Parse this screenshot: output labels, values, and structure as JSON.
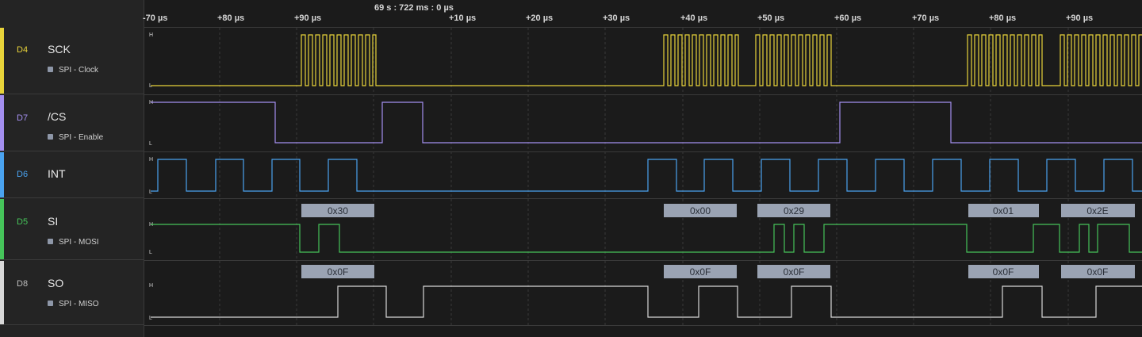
{
  "ruler": {
    "cursor_time": "69 s : 722 ms : 0 µs",
    "ticks": [
      "-70 µs",
      "+80 µs",
      "+90 µs",
      "+10 µs",
      "+20 µs",
      "+30 µs",
      "+40 µs",
      "+50 µs",
      "+60 µs",
      "+70 µs",
      "+80 µs",
      "+90 µs"
    ]
  },
  "channels": [
    {
      "id": "D4",
      "name": "SCK",
      "analyzer": "SPI - Clock",
      "color": "#e8d33a"
    },
    {
      "id": "D7",
      "name": "/CS",
      "analyzer": "SPI - Enable",
      "color": "#a48ff0"
    },
    {
      "id": "D6",
      "name": "INT",
      "analyzer": "",
      "color": "#4aa3f0"
    },
    {
      "id": "D5",
      "name": "SI",
      "analyzer": "SPI - MOSI",
      "color": "#46c45a"
    },
    {
      "id": "D8",
      "name": "SO",
      "analyzer": "SPI - MISO",
      "color": "#d8d8d8"
    }
  ],
  "level_labels": {
    "high": "H",
    "low": "L"
  },
  "decodes": {
    "mosi": [
      "0x30",
      "0x00",
      "0x29",
      "0x01",
      "0x2E"
    ],
    "miso": [
      "0x0F",
      "0x0F",
      "0x0F",
      "0x0F",
      "0x0F"
    ]
  }
}
